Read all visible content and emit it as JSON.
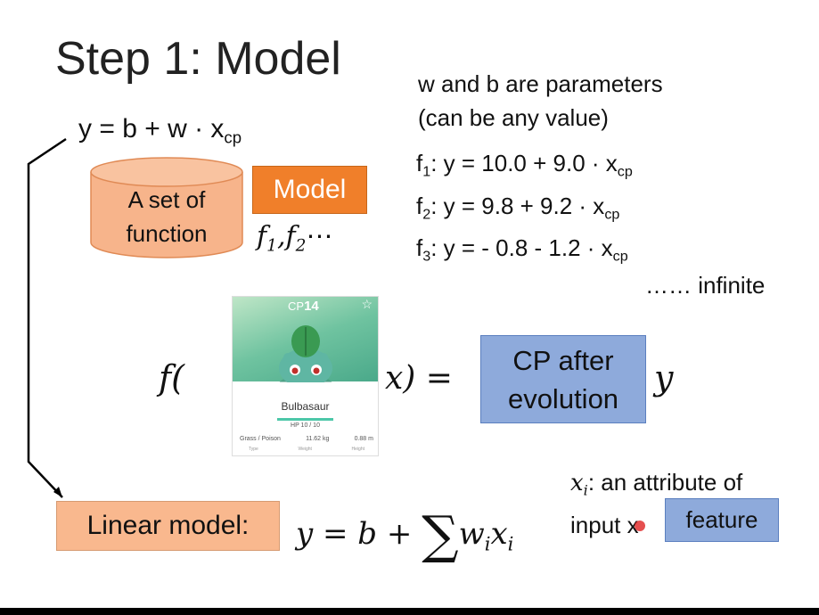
{
  "slide": {
    "title": "Step 1: Model",
    "model_eq": {
      "main": "y = b + w · x",
      "sub": "cp"
    },
    "params_note": [
      "w and b are parameters",
      "(can be any value)"
    ],
    "functions": [
      {
        "name": "f",
        "idx": "1",
        "expr": ": y = 10.0 + 9.0 · x",
        "sub": "cp"
      },
      {
        "name": "f",
        "idx": "2",
        "expr": ": y = 9.8 + 9.2 · x",
        "sub": "cp"
      },
      {
        "name": "f",
        "idx": "3",
        "expr": ": y = - 0.8 - 1.2 · x",
        "sub": "cp"
      }
    ],
    "infinite": "…… infinite",
    "set_label": [
      "A set of",
      "function"
    ],
    "model_label": "Model",
    "fset": {
      "f1": "f",
      "i1": "1",
      "sep": ",",
      "f2": "f",
      "i2": "2",
      "dots": "⋯"
    },
    "func_left": "f(",
    "func_right": "x) =",
    "output_box": [
      "CP after",
      "evolution"
    ],
    "output_var": "y",
    "card": {
      "cp_prefix": "CP",
      "cp_value": "14",
      "name": "Bulbasaur",
      "hp": "HP 10 / 10",
      "stats": [
        "Grass / Poison",
        "11.62 kg",
        "0.88 m"
      ],
      "stat_labels": [
        "Type",
        "Weight",
        "Height"
      ]
    },
    "linear_label": "Linear model:",
    "linear_eq": {
      "lhs": "y = b + ",
      "sum": "∑",
      "w": "w",
      "wi": "i",
      "x": "x",
      "xi": "i"
    },
    "attr_note": {
      "x": "x",
      "xi": "i",
      "text1": ": an attribute of",
      "text2": "input x"
    },
    "feature_label": "feature"
  },
  "colors": {
    "model": "#f07f2a",
    "cylinder": "#f7b48b",
    "linear_box": "#f9b88e",
    "blue_box": "#8eaadb",
    "pointer": "#e03030"
  }
}
